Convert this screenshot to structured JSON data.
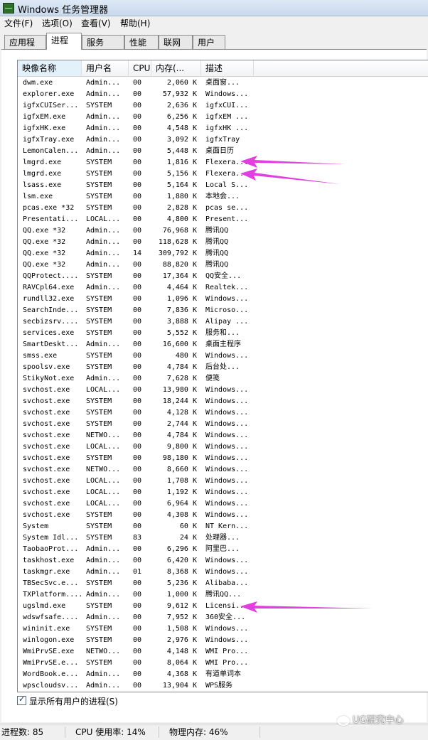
{
  "window": {
    "title": "Windows 任务管理器"
  },
  "menu": [
    "文件(F)",
    "选项(O)",
    "查看(V)",
    "帮助(H)"
  ],
  "tabs": [
    "应用程序",
    "进程",
    "服务",
    "性能",
    "联网",
    "用户"
  ],
  "active_tab": 1,
  "columns": {
    "name": "映像名称",
    "user": "用户名",
    "cpu": "CPU",
    "mem": "内存(...",
    "desc": "描述"
  },
  "processes": [
    {
      "name": "dwm.exe",
      "user": "Admin...",
      "cpu": "00",
      "mem": "2,060 K",
      "desc": "桌面窗..."
    },
    {
      "name": "explorer.exe",
      "user": "Admin...",
      "cpu": "00",
      "mem": "57,932 K",
      "desc": "Windows..."
    },
    {
      "name": "igfxCUISer...",
      "user": "SYSTEM",
      "cpu": "00",
      "mem": "2,636 K",
      "desc": "igfxCUI..."
    },
    {
      "name": "igfxEM.exe",
      "user": "Admin...",
      "cpu": "00",
      "mem": "6,256 K",
      "desc": "igfxEM ..."
    },
    {
      "name": "igfxHK.exe",
      "user": "Admin...",
      "cpu": "00",
      "mem": "4,548 K",
      "desc": "igfxHK ..."
    },
    {
      "name": "igfxTray.exe",
      "user": "Admin...",
      "cpu": "00",
      "mem": "3,092 K",
      "desc": "igfxTray"
    },
    {
      "name": "LemonCalen...",
      "user": "Admin...",
      "cpu": "00",
      "mem": "5,448 K",
      "desc": "桌面日历"
    },
    {
      "name": "lmgrd.exe",
      "user": "SYSTEM",
      "cpu": "00",
      "mem": "1,816 K",
      "desc": "Flexera..."
    },
    {
      "name": "lmgrd.exe",
      "user": "SYSTEM",
      "cpu": "00",
      "mem": "5,156 K",
      "desc": "Flexera..."
    },
    {
      "name": "lsass.exe",
      "user": "SYSTEM",
      "cpu": "00",
      "mem": "5,164 K",
      "desc": "Local S..."
    },
    {
      "name": "lsm.exe",
      "user": "SYSTEM",
      "cpu": "00",
      "mem": "1,880 K",
      "desc": "本地会..."
    },
    {
      "name": "pcas.exe *32",
      "user": "SYSTEM",
      "cpu": "00",
      "mem": "2,828 K",
      "desc": "pcas se..."
    },
    {
      "name": "Presentati...",
      "user": "LOCAL...",
      "cpu": "00",
      "mem": "4,800 K",
      "desc": "Present..."
    },
    {
      "name": "QQ.exe *32",
      "user": "Admin...",
      "cpu": "00",
      "mem": "76,968 K",
      "desc": "腾讯QQ"
    },
    {
      "name": "QQ.exe *32",
      "user": "Admin...",
      "cpu": "00",
      "mem": "118,628 K",
      "desc": "腾讯QQ"
    },
    {
      "name": "QQ.exe *32",
      "user": "Admin...",
      "cpu": "14",
      "mem": "309,792 K",
      "desc": "腾讯QQ"
    },
    {
      "name": "QQ.exe *32",
      "user": "Admin...",
      "cpu": "00",
      "mem": "88,820 K",
      "desc": "腾讯QQ"
    },
    {
      "name": "QQProtect....",
      "user": "SYSTEM",
      "cpu": "00",
      "mem": "17,364 K",
      "desc": "QQ安全..."
    },
    {
      "name": "RAVCpl64.exe",
      "user": "Admin...",
      "cpu": "00",
      "mem": "4,464 K",
      "desc": "Realtek..."
    },
    {
      "name": "rundll32.exe",
      "user": "SYSTEM",
      "cpu": "00",
      "mem": "1,096 K",
      "desc": "Windows..."
    },
    {
      "name": "SearchInde...",
      "user": "SYSTEM",
      "cpu": "00",
      "mem": "7,836 K",
      "desc": "Microso..."
    },
    {
      "name": "secbizsrv....",
      "user": "SYSTEM",
      "cpu": "00",
      "mem": "3,888 K",
      "desc": "Alipay ..."
    },
    {
      "name": "services.exe",
      "user": "SYSTEM",
      "cpu": "00",
      "mem": "5,552 K",
      "desc": "服务和..."
    },
    {
      "name": "SmartDeskt...",
      "user": "Admin...",
      "cpu": "00",
      "mem": "16,600 K",
      "desc": "桌面主程序"
    },
    {
      "name": "smss.exe",
      "user": "SYSTEM",
      "cpu": "00",
      "mem": "480 K",
      "desc": "Windows..."
    },
    {
      "name": "spoolsv.exe",
      "user": "SYSTEM",
      "cpu": "00",
      "mem": "4,784 K",
      "desc": "后台处..."
    },
    {
      "name": "StikyNot.exe",
      "user": "Admin...",
      "cpu": "00",
      "mem": "7,628 K",
      "desc": "便笺"
    },
    {
      "name": "svchost.exe",
      "user": "LOCAL...",
      "cpu": "00",
      "mem": "13,980 K",
      "desc": "Windows..."
    },
    {
      "name": "svchost.exe",
      "user": "SYSTEM",
      "cpu": "00",
      "mem": "18,244 K",
      "desc": "Windows..."
    },
    {
      "name": "svchost.exe",
      "user": "SYSTEM",
      "cpu": "00",
      "mem": "4,128 K",
      "desc": "Windows..."
    },
    {
      "name": "svchost.exe",
      "user": "SYSTEM",
      "cpu": "00",
      "mem": "2,744 K",
      "desc": "Windows..."
    },
    {
      "name": "svchost.exe",
      "user": "NETWO...",
      "cpu": "00",
      "mem": "4,784 K",
      "desc": "Windows..."
    },
    {
      "name": "svchost.exe",
      "user": "LOCAL...",
      "cpu": "00",
      "mem": "9,800 K",
      "desc": "Windows..."
    },
    {
      "name": "svchost.exe",
      "user": "SYSTEM",
      "cpu": "00",
      "mem": "98,180 K",
      "desc": "Windows..."
    },
    {
      "name": "svchost.exe",
      "user": "NETWO...",
      "cpu": "00",
      "mem": "8,660 K",
      "desc": "Windows..."
    },
    {
      "name": "svchost.exe",
      "user": "LOCAL...",
      "cpu": "00",
      "mem": "1,708 K",
      "desc": "Windows..."
    },
    {
      "name": "svchost.exe",
      "user": "LOCAL...",
      "cpu": "00",
      "mem": "1,192 K",
      "desc": "Windows..."
    },
    {
      "name": "svchost.exe",
      "user": "LOCAL...",
      "cpu": "00",
      "mem": "6,964 K",
      "desc": "Windows..."
    },
    {
      "name": "svchost.exe",
      "user": "SYSTEM",
      "cpu": "00",
      "mem": "4,308 K",
      "desc": "Windows..."
    },
    {
      "name": "System",
      "user": "SYSTEM",
      "cpu": "00",
      "mem": "60 K",
      "desc": "NT Kern..."
    },
    {
      "name": "System Idl...",
      "user": "SYSTEM",
      "cpu": "83",
      "mem": "24 K",
      "desc": "处理器..."
    },
    {
      "name": "TaobaoProt...",
      "user": "Admin...",
      "cpu": "00",
      "mem": "6,296 K",
      "desc": "阿里巴..."
    },
    {
      "name": "taskhost.exe",
      "user": "Admin...",
      "cpu": "00",
      "mem": "6,420 K",
      "desc": "Windows..."
    },
    {
      "name": "taskmgr.exe",
      "user": "Admin...",
      "cpu": "01",
      "mem": "8,368 K",
      "desc": "Windows..."
    },
    {
      "name": "TBSecSvc.e...",
      "user": "SYSTEM",
      "cpu": "00",
      "mem": "5,236 K",
      "desc": "Alibaba..."
    },
    {
      "name": "TXPlatform....",
      "user": "Admin...",
      "cpu": "00",
      "mem": "1,000 K",
      "desc": "腾讯QQ..."
    },
    {
      "name": "ugslmd.exe",
      "user": "SYSTEM",
      "cpu": "00",
      "mem": "9,612 K",
      "desc": "Licensi..."
    },
    {
      "name": "wdswfsafe....",
      "user": "Admin...",
      "cpu": "00",
      "mem": "7,952 K",
      "desc": "360安全..."
    },
    {
      "name": "wininit.exe",
      "user": "SYSTEM",
      "cpu": "00",
      "mem": "1,508 K",
      "desc": "Windows..."
    },
    {
      "name": "winlogon.exe",
      "user": "SYSTEM",
      "cpu": "00",
      "mem": "2,976 K",
      "desc": "Windows..."
    },
    {
      "name": "WmiPrvSE.exe",
      "user": "NETWO...",
      "cpu": "00",
      "mem": "4,148 K",
      "desc": "WMI Pro..."
    },
    {
      "name": "WmiPrvSE.e...",
      "user": "SYSTEM",
      "cpu": "00",
      "mem": "8,064 K",
      "desc": "WMI Pro..."
    },
    {
      "name": "WordBook.e...",
      "user": "Admin...",
      "cpu": "00",
      "mem": "4,368 K",
      "desc": "有道单词本"
    },
    {
      "name": "wpscloudsv...",
      "user": "Admin...",
      "cpu": "00",
      "mem": "13,904 K",
      "desc": "WPS服务"
    }
  ],
  "show_all_users": {
    "label": "显示所有用户的进程(S)",
    "checked": true
  },
  "status": {
    "processes": "进程数: 85",
    "cpu": "CPU 使用率: 14%",
    "memory": "物理内存: 46%"
  },
  "watermark": "UG研究中心",
  "annotation_color": "#e040e0",
  "icons": {
    "app": "task-manager-icon",
    "checkbox": "checkmark-icon",
    "watermark": "wechat-icon"
  }
}
